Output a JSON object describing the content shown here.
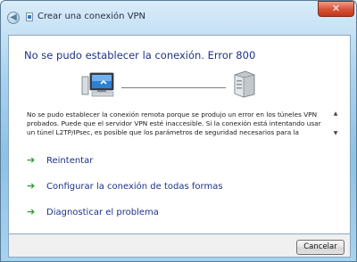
{
  "window": {
    "title": "Crear una conexión VPN",
    "close_label": "✕"
  },
  "main": {
    "heading": "No se pudo establecer la conexión. Error 800",
    "message": "No se pudo establecer la conexión remota porque se produjo un error en los túneles VPN probados. Puede que el servidor VPN esté inaccesible. Si la conexión está intentando usar un túnel L2TP/IPsec, es posible que los parámetros de seguridad necesarios para la negociación",
    "options": [
      {
        "label": "Reintentar",
        "icon": "green-arrow-icon"
      },
      {
        "label": "Configurar la conexión de todas formas",
        "icon": "green-arrow-icon"
      },
      {
        "label": "Diagnosticar el problema",
        "icon": "green-arrow-icon"
      }
    ]
  },
  "footer": {
    "cancel_label": "Cancelar"
  },
  "colors": {
    "heading": "#1e3287",
    "link": "#1e3287",
    "arrow": "#2f9b31"
  }
}
